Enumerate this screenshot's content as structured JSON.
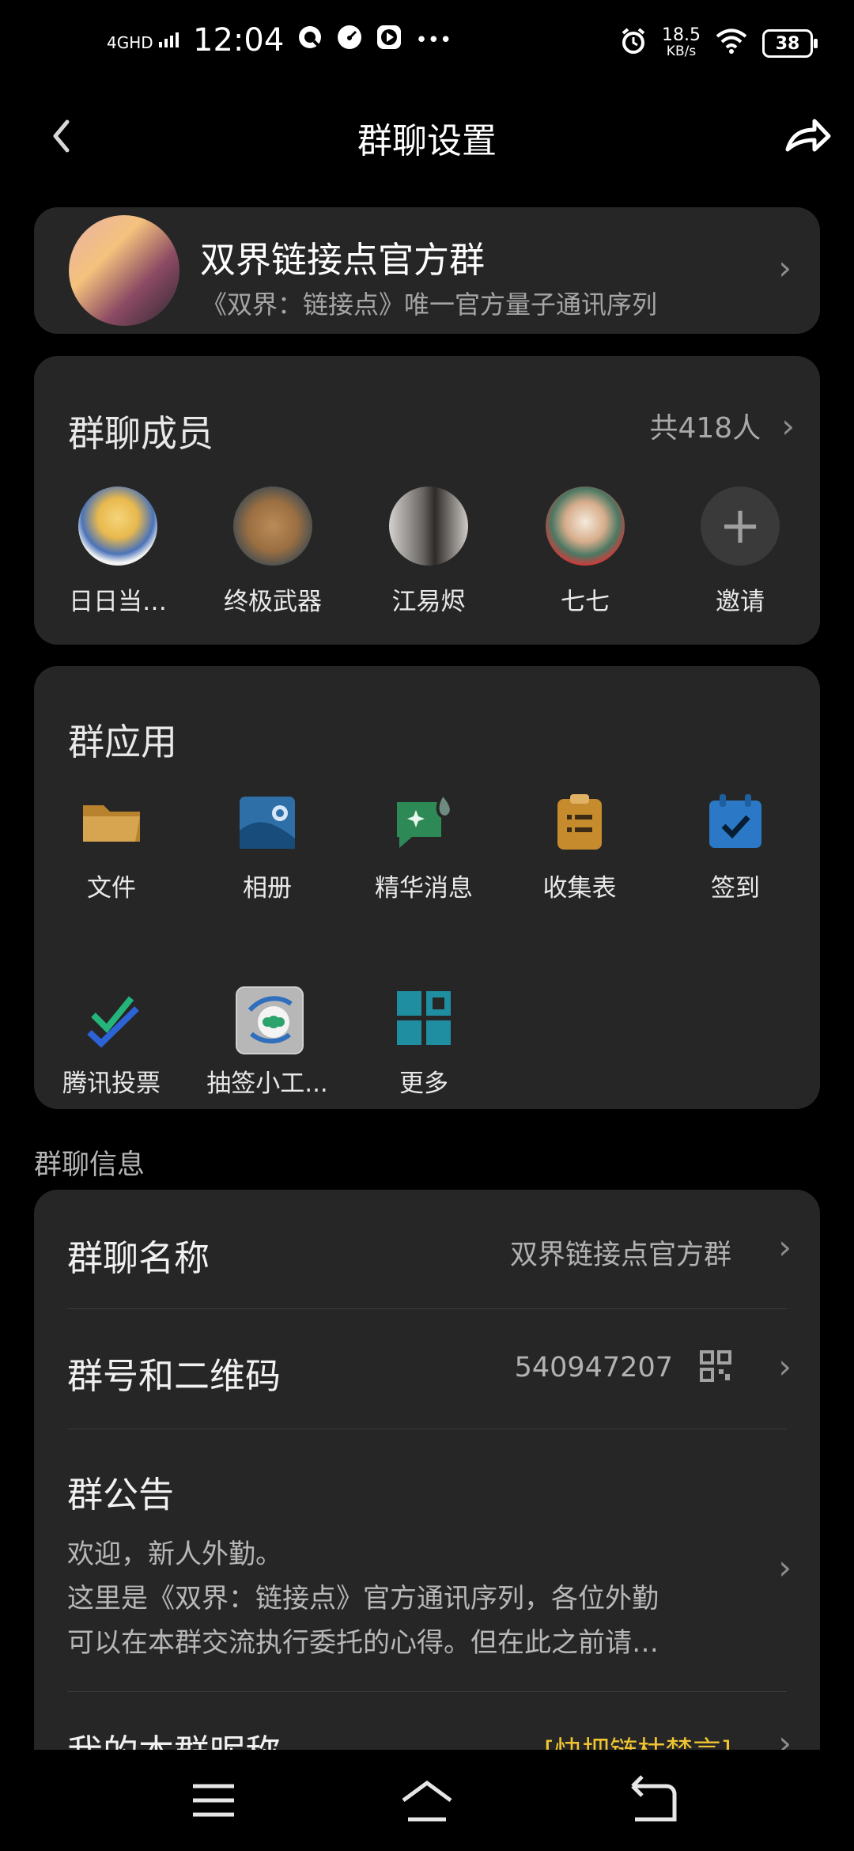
{
  "status_bar": {
    "time": "12:04",
    "network": "4GHD",
    "speed_value": "18.5",
    "speed_unit": "KB/s",
    "battery": "38",
    "more": "•••"
  },
  "header": {
    "title": "群聊设置"
  },
  "group": {
    "name": "双界链接点官方群",
    "description": "《双界：链接点》唯一官方量子通讯序列"
  },
  "members": {
    "title": "群聊成员",
    "count_label": "共418人",
    "list": [
      {
        "name": "日日当…"
      },
      {
        "name": "终极武器"
      },
      {
        "name": "江易烬"
      },
      {
        "name": "七七"
      },
      {
        "name": "邀请"
      }
    ]
  },
  "apps": {
    "title": "群应用",
    "items": [
      {
        "label": "文件",
        "icon": "folder-icon"
      },
      {
        "label": "相册",
        "icon": "album-icon"
      },
      {
        "label": "精华消息",
        "icon": "essence-message-icon"
      },
      {
        "label": "收集表",
        "icon": "clipboard-icon"
      },
      {
        "label": "签到",
        "icon": "checkin-calendar-icon"
      },
      {
        "label": "腾讯投票",
        "icon": "vote-check-icon"
      },
      {
        "label": "抽签小工...",
        "icon": "lottery-tool-icon"
      },
      {
        "label": "更多",
        "icon": "grid-more-icon"
      }
    ]
  },
  "info": {
    "section_label": "群聊信息",
    "group_name_label": "群聊名称",
    "group_name_value": "双界链接点官方群",
    "group_number_label": "群号和二维码",
    "group_number_value": "540947207",
    "notice_label": "群公告",
    "notice_lines": [
      "欢迎，新人外勤。",
      "这里是《双界：链接点》官方通讯序列，各位外勤",
      "可以在本群交流执行委托的心得。但在此之前请…"
    ],
    "nickname_label": "我的本群昵称",
    "nickname_value": "[快把链枯禁言]"
  },
  "colors": {
    "background": "#000000",
    "card": "#262626",
    "secondary_text": "#a5a5a5",
    "folder": "#c89b44",
    "album": "#2e6fa8",
    "essence": "#2d8a57",
    "clipboard": "#c58b2d",
    "calendar": "#2b79c6",
    "more_grid": "#1f8ea0"
  }
}
